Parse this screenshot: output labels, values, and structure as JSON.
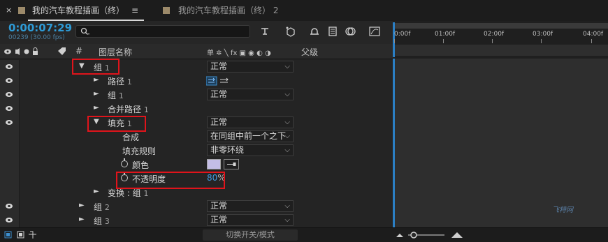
{
  "tabs": [
    {
      "label": "我的汽车教程插画（终）",
      "color": "#9c8a6a",
      "active": true
    },
    {
      "label": "我的汽车教程插画（终）",
      "count": "2",
      "color": "#9c8a6a",
      "active": false
    }
  ],
  "tab_close": "×",
  "tab_menu": "≡",
  "header": {
    "timecode": "0:00:07:29",
    "fps": "00239 (30.00 fps)",
    "search_placeholder": "",
    "search_icon": "magnifier-icon"
  },
  "columns": {
    "hash": "#",
    "layer_name": "图层名称",
    "switches": "单 ✲ ╲ fx ▣ ◉ ◐ ◑",
    "parent": "父级"
  },
  "rows": [
    {
      "name": "组",
      "num": "1",
      "mode": "正常",
      "expanded": true,
      "eye": true
    },
    {
      "name": "路径",
      "num": "1",
      "eye": true,
      "has_path_icons": true
    },
    {
      "name": "组",
      "num": "1",
      "mode": "正常",
      "eye": true
    },
    {
      "name": "合并路径",
      "num": "1",
      "eye": true
    },
    {
      "name": "填充",
      "num": "1",
      "mode": "正常",
      "expanded": true,
      "eye": true
    },
    {
      "name": "合成",
      "mode": "在同组中前一个之下"
    },
    {
      "name": "填充规则",
      "mode": "非零环绕"
    },
    {
      "name": "颜色",
      "stopwatch": true,
      "color_swatch": "#c3bde6"
    },
    {
      "name": "不透明度",
      "stopwatch": true,
      "value": "80",
      "unit": "%"
    },
    {
      "name": "变换 : 组",
      "num": "1"
    },
    {
      "name": "组",
      "num": "2",
      "mode": "正常",
      "eye": true
    },
    {
      "name": "组",
      "num": "3",
      "mode": "正常",
      "eye": true
    }
  ],
  "ruler": {
    "ticks": [
      "0:00f",
      "01:00f",
      "02:00f",
      "03:00f",
      "04:00f"
    ]
  },
  "footer": {
    "toggle_label": "切换开关/模式"
  },
  "watermark": "飞特网",
  "colors": {
    "accent": "#2e9bd6",
    "highlight": "#e0141b",
    "swatch": "#c3bde6"
  }
}
